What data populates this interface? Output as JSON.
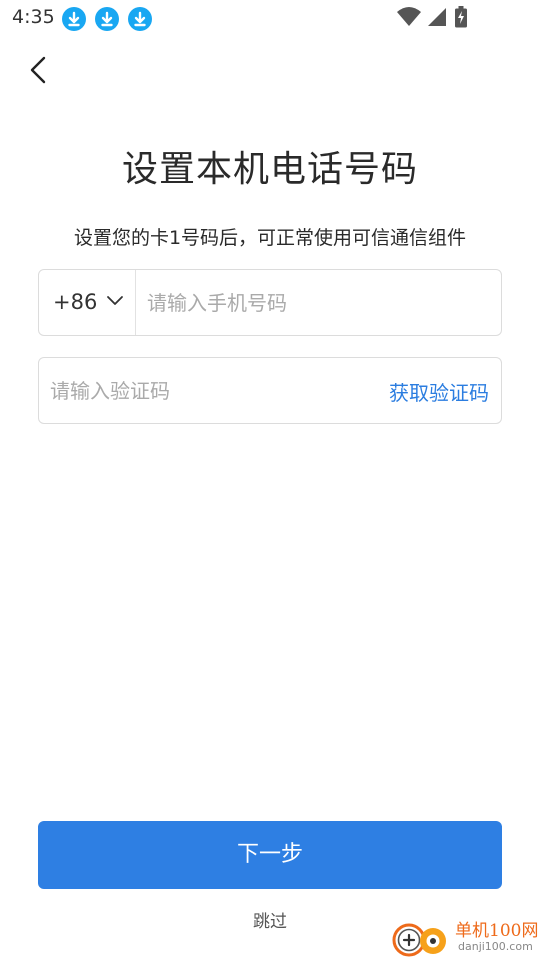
{
  "status_bar": {
    "time": "4:35",
    "notification_icons": [
      "download-icon",
      "download-icon",
      "download-icon"
    ],
    "right_icons": [
      "wifi-icon",
      "signal-icon",
      "battery-charging-icon"
    ]
  },
  "header": {
    "back_icon": "back-arrow-icon",
    "title": "设置本机电话号码",
    "subtitle": "设置您的卡1号码后，可正常使用可信通信组件"
  },
  "phone_field": {
    "country_code": "+86",
    "placeholder": "请输入手机号码",
    "value": ""
  },
  "code_field": {
    "placeholder": "请输入验证码",
    "value": "",
    "get_code_label": "获取验证码"
  },
  "actions": {
    "next_label": "下一步",
    "skip_label": "跳过"
  },
  "watermark": {
    "title": "单机100网",
    "subtitle": "danji100.com"
  },
  "colors": {
    "accent": "#2e7fe3",
    "link": "#2b7de0",
    "notification": "#19a7f2",
    "watermark": "#ee6a1a"
  }
}
